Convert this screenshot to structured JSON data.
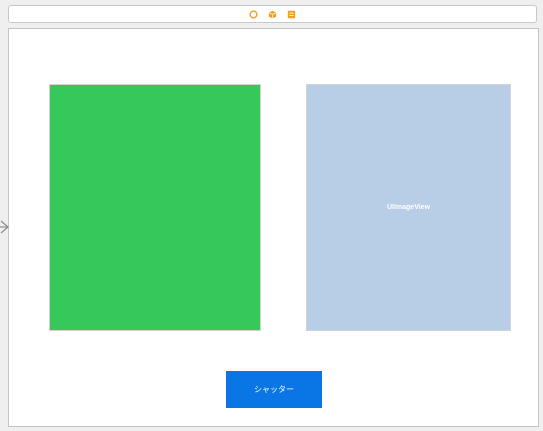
{
  "colors": {
    "green_view": "#37c85b",
    "image_view": "#b8cde6",
    "shutter_button": "#0a76e6",
    "dock_icon_orange": "#f0a020"
  },
  "scene_dock": {
    "icons": [
      "view-controller-icon",
      "first-responder-icon",
      "exit-icon"
    ]
  },
  "image_view": {
    "label": "UIImageView"
  },
  "shutter_button": {
    "label": "シャッター"
  }
}
